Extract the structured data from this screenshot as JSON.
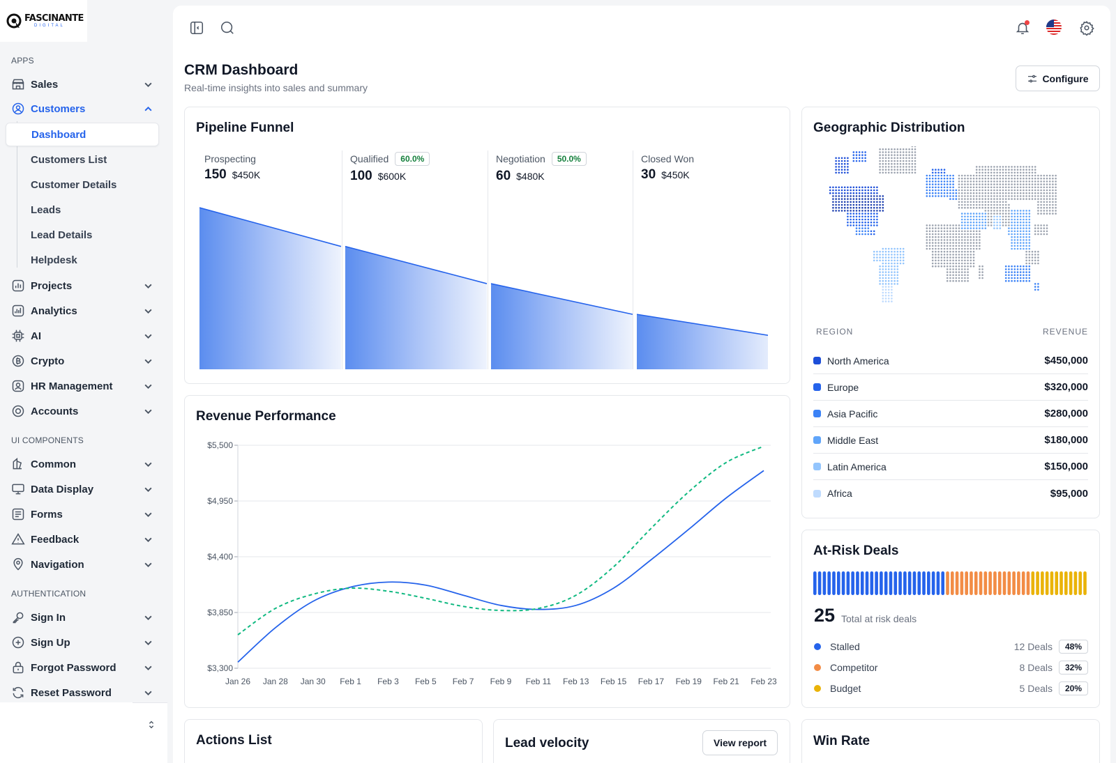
{
  "brand": {
    "name": "FASCINANTE",
    "tagline": "DIGITAL"
  },
  "sidebar": {
    "sections": {
      "apps": "APPS",
      "ui": "UI COMPONENTS",
      "auth": "AUTHENTICATION"
    },
    "items": [
      {
        "label": "Sales",
        "icon": "store-icon"
      },
      {
        "label": "Customers",
        "icon": "user-circle-icon"
      },
      {
        "label": "Projects",
        "icon": "chart-bars-icon"
      },
      {
        "label": "Analytics",
        "icon": "analytics-icon"
      },
      {
        "label": "AI",
        "icon": "chip-icon"
      },
      {
        "label": "Crypto",
        "icon": "bitcoin-icon"
      },
      {
        "label": "HR Management",
        "icon": "id-badge-icon"
      },
      {
        "label": "Accounts",
        "icon": "target-icon"
      },
      {
        "label": "Common",
        "icon": "palette-icon"
      },
      {
        "label": "Data Display",
        "icon": "monitor-icon"
      },
      {
        "label": "Forms",
        "icon": "form-icon"
      },
      {
        "label": "Feedback",
        "icon": "warning-icon"
      },
      {
        "label": "Navigation",
        "icon": "map-pin-icon"
      },
      {
        "label": "Sign In",
        "icon": "key-icon"
      },
      {
        "label": "Sign Up",
        "icon": "plus-circle-icon"
      },
      {
        "label": "Forgot Password",
        "icon": "lock-icon"
      },
      {
        "label": "Reset Password",
        "icon": "refresh-icon"
      }
    ],
    "customers_sub": [
      "Dashboard",
      "Customers List",
      "Customer Details",
      "Leads",
      "Lead Details",
      "Helpdesk"
    ]
  },
  "header": {
    "title": "CRM Dashboard",
    "subtitle": "Real-time insights into sales and summary",
    "configure_label": "Configure"
  },
  "pipeline": {
    "title": "Pipeline Funnel",
    "stages": [
      {
        "name": "Prospecting",
        "count": "150",
        "amount": "$450K",
        "badge": ""
      },
      {
        "name": "Qualified",
        "count": "100",
        "amount": "$600K",
        "badge": "60.0%"
      },
      {
        "name": "Negotiation",
        "count": "60",
        "amount": "$480K",
        "badge": "50.0%"
      },
      {
        "name": "Closed Won",
        "count": "30",
        "amount": "$450K",
        "badge": ""
      }
    ],
    "funnel_levels": [
      1.0,
      0.76,
      0.53,
      0.34,
      0.2
    ]
  },
  "revenue": {
    "title": "Revenue Performance"
  },
  "chart_data": {
    "type": "line",
    "title": "Revenue Performance",
    "x": [
      "Jan 26",
      "Jan 28",
      "Jan 30",
      "Feb 1",
      "Feb 3",
      "Feb 5",
      "Feb 7",
      "Feb 9",
      "Feb 11",
      "Feb 13",
      "Feb 15",
      "Feb 17",
      "Feb 19",
      "Feb 21",
      "Feb 23"
    ],
    "yticks": [
      "$5,500",
      "$4,950",
      "$4,400",
      "$3,850",
      "$3,300"
    ],
    "ylim": [
      3300,
      5500
    ],
    "series": [
      {
        "values": [
          3360,
          3700,
          3960,
          4100,
          4150,
          4120,
          4020,
          3920,
          3880,
          3920,
          4090,
          4370,
          4670,
          4980,
          5250
        ],
        "color": "#2563eb",
        "dash": false
      },
      {
        "values": [
          3630,
          3890,
          4030,
          4090,
          4060,
          3990,
          3910,
          3870,
          3890,
          4020,
          4300,
          4680,
          5040,
          5330,
          5490
        ],
        "color": "#10b981",
        "dash": true
      }
    ],
    "grid": true
  },
  "geo": {
    "title": "Geographic Distribution",
    "col_region": "REGION",
    "col_revenue": "REVENUE",
    "rows": [
      {
        "region": "North America",
        "revenue": "$450,000",
        "color": "#1d4ed8"
      },
      {
        "region": "Europe",
        "revenue": "$320,000",
        "color": "#2563eb"
      },
      {
        "region": "Asia Pacific",
        "revenue": "$280,000",
        "color": "#3b82f6"
      },
      {
        "region": "Middle East",
        "revenue": "$180,000",
        "color": "#60a5fa"
      },
      {
        "region": "Latin America",
        "revenue": "$150,000",
        "color": "#93c5fd"
      },
      {
        "region": "Africa",
        "revenue": "$95,000",
        "color": "#bfdbfe"
      }
    ]
  },
  "risk": {
    "title": "At-Risk Deals",
    "total": "25",
    "total_label": "Total at risk deals",
    "rows": [
      {
        "label": "Stalled",
        "deals": "12 Deals",
        "pct": "48%",
        "color": "#2563eb",
        "share": 0.48
      },
      {
        "label": "Competitor",
        "deals": "8 Deals",
        "pct": "32%",
        "color": "#f28c45",
        "share": 0.32
      },
      {
        "label": "Budget",
        "deals": "5 Deals",
        "pct": "20%",
        "color": "#eab308",
        "share": 0.2
      }
    ]
  },
  "bottom": {
    "actions_title": "Actions List",
    "velocity_title": "Lead velocity",
    "view_report": "View report",
    "winrate_title": "Win Rate"
  },
  "colors": {
    "accent": "#2563eb",
    "positive": "#15803d",
    "alert_dot": "#ef4444"
  }
}
